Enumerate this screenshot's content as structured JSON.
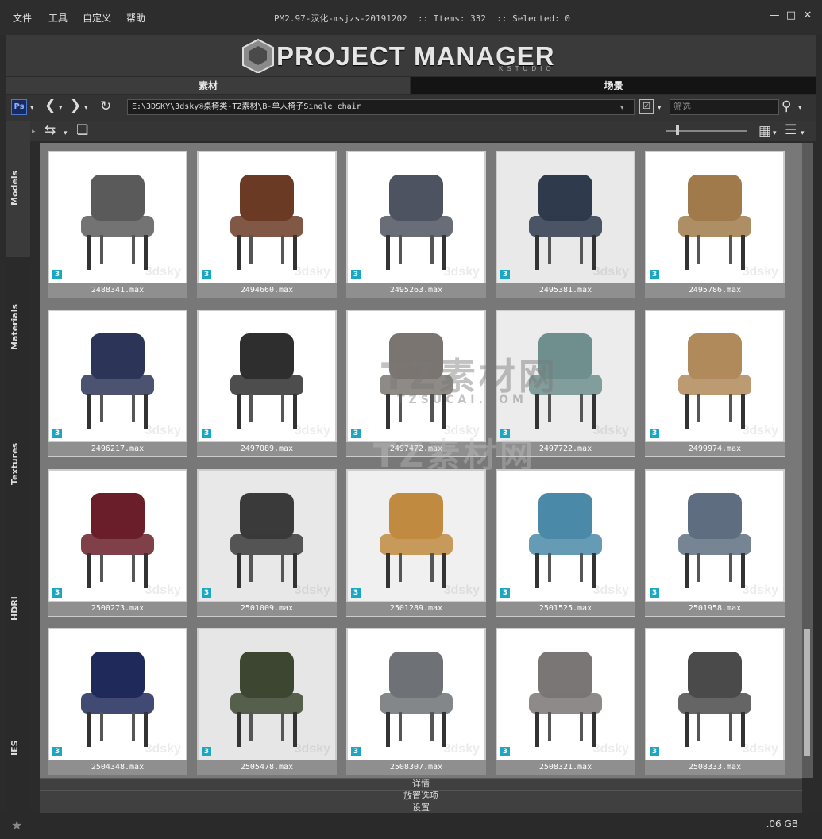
{
  "menu": [
    "文件",
    "工具",
    "自定义",
    "帮助"
  ],
  "window": {
    "title": "PM2.97-汉化-msjzs-20191202  :: Items: 332  :: Selected: 0"
  },
  "banner": {
    "logo": "PROJECT MANAGER",
    "sub": "KSTUDIO"
  },
  "tabs": [
    {
      "label": "素材",
      "active": true
    },
    {
      "label": "场景",
      "active": false
    }
  ],
  "toolbar": {
    "path": "E:\\3DSKY\\3dsky®桌椅类-TZ素材\\B-单人椅子Single chair",
    "filter_placeholder": "筛选",
    "ps_label": "Ps"
  },
  "sidebar": [
    "Models",
    "Materials",
    "Textures",
    "HDRI",
    "IES"
  ],
  "items": [
    "2488341.max",
    "2494660.max",
    "2495263.max",
    "2495381.max",
    "2495786.max",
    "2496217.max",
    "2497089.max",
    "2497472.max",
    "2497722.max",
    "2499974.max",
    "2500273.max",
    "2501009.max",
    "2501289.max",
    "2501525.max",
    "2501958.max",
    "2504348.max",
    "2505478.max",
    "2508307.max",
    "2508321.max",
    "2508333.max"
  ],
  "item_colors": [
    "#5a5a5a",
    "#6b3a24",
    "#4d5360",
    "#2f3a4c",
    "#a07a4a",
    "#2c3557",
    "#2e2e2e",
    "#7a7570",
    "#6e8f8e",
    "#b08a5a",
    "#6a1e2a",
    "#3a3a3a",
    "#c08a40",
    "#4a8aa8",
    "#5e6e80",
    "#1f2a5a",
    "#3c4630",
    "#6e7276",
    "#7a7676",
    "#4a4a4a"
  ],
  "item_bg": [
    "#ffffff",
    "#ffffff",
    "#ffffff",
    "#e9e9e9",
    "#ffffff",
    "#ffffff",
    "#ffffff",
    "#ffffff",
    "#ececec",
    "#ffffff",
    "#ffffff",
    "#e8e8e8",
    "#f0f0f0",
    "#ffffff",
    "#ffffff",
    "#ffffff",
    "#e6e6e6",
    "#ffffff",
    "#ffffff",
    "#ffffff"
  ],
  "watermark": {
    "main": "TZ素材网",
    "sub": "TZSUCAI.COM",
    "main2": "TZ素材网",
    "card": "3dsky"
  },
  "bottom": {
    "details": "详情",
    "placement": "放置选项",
    "settings": "设置"
  },
  "status": {
    "size": ".06 GB"
  },
  "badge_label": "3"
}
